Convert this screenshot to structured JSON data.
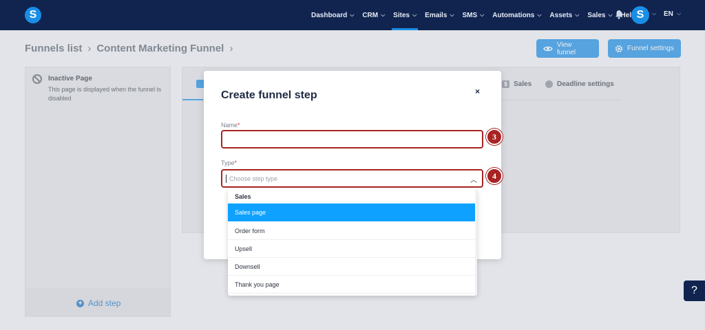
{
  "navbar": {
    "logo_letter": "S",
    "items": [
      {
        "label": "Dashboard",
        "chevron": true,
        "active": false
      },
      {
        "label": "CRM",
        "chevron": true,
        "active": false
      },
      {
        "label": "Sites",
        "chevron": true,
        "active": true
      },
      {
        "label": "Emails",
        "chevron": true,
        "active": false
      },
      {
        "label": "SMS",
        "chevron": true,
        "active": false
      },
      {
        "label": "Automations",
        "chevron": true,
        "active": false
      },
      {
        "label": "Assets",
        "chevron": true,
        "active": false
      },
      {
        "label": "Sales",
        "chevron": true,
        "active": false
      },
      {
        "label": "Help",
        "chevron": false,
        "active": false
      }
    ],
    "avatar_letter": "S",
    "language": "EN",
    "bg_color": "#10244f",
    "accent_color": "#1a8ee6"
  },
  "breadcrumb": {
    "parent": "Funnels list",
    "current": "Content Marketing Funnel"
  },
  "actions": {
    "view_funnel": "View funnel",
    "funnel_settings": "Funnel settings"
  },
  "left_panel": {
    "inactive_title": "Inactive Page",
    "inactive_desc": "This page is displayed when the funnel is disabled",
    "add_step": "Add step"
  },
  "main_tabs": {
    "sales": "Sales",
    "deadline": "Deadline settings"
  },
  "modal": {
    "title": "Create funnel step",
    "close": "×",
    "name_label": "Name",
    "type_label": "Type",
    "required_mark": "*",
    "type_placeholder": "Choose step type"
  },
  "badges": {
    "name": "3",
    "type": "4",
    "color": "#a82323"
  },
  "dropdown": {
    "group": "Sales",
    "options": [
      {
        "label": "Sales page",
        "selected": true
      },
      {
        "label": "Order form",
        "selected": false
      },
      {
        "label": "Upsell",
        "selected": false
      },
      {
        "label": "Downsell",
        "selected": false
      },
      {
        "label": "Thank you page",
        "selected": false
      }
    ]
  },
  "help": "?"
}
